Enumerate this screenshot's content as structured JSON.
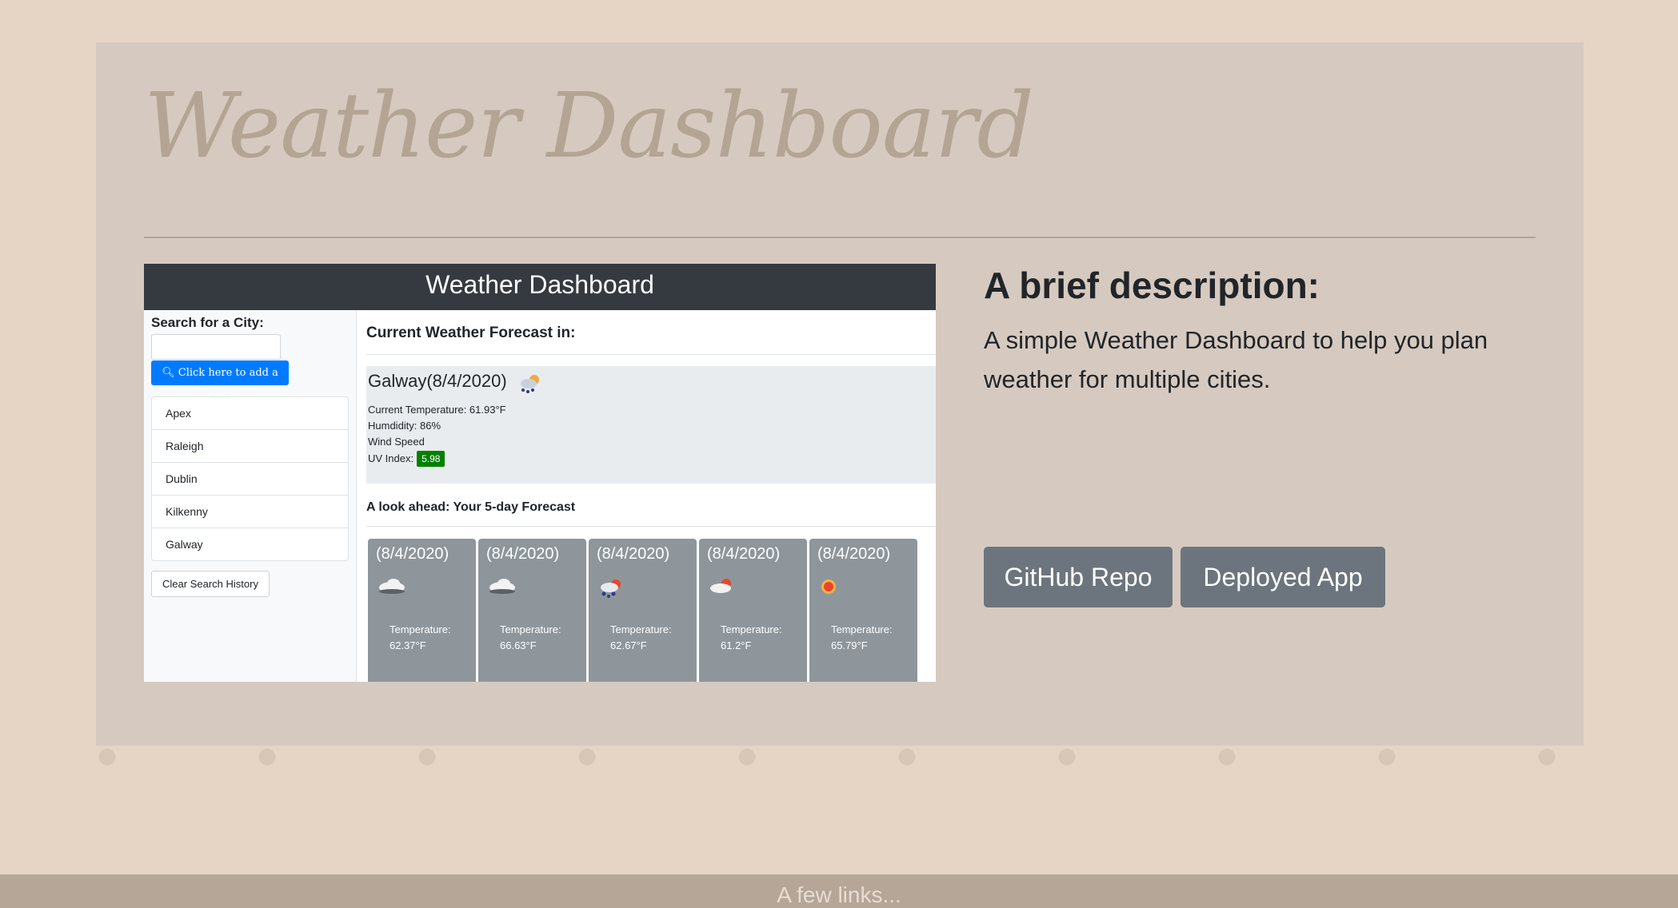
{
  "header": {
    "title": "Weather Dashboard"
  },
  "preview": {
    "app_title": "Weather Dashboard",
    "sidebar": {
      "search_label": "Search for a City:",
      "search_value": "",
      "add_button_label": "Click here to add a City!",
      "cities": [
        "Apex",
        "Raleigh",
        "Dublin",
        "Kilkenny",
        "Galway"
      ],
      "clear_button_label": "Clear Search History"
    },
    "current": {
      "section_title": "Current Weather Forecast in:",
      "city_date": "Galway(8/4/2020)",
      "icon": "rain-sun-icon",
      "temperature": "Current Temperature: 61.93°F",
      "humidity": "Humdidity: 86%",
      "wind": "Wind Speed",
      "uv_label": "UV Index:",
      "uv_value": "5.98",
      "uv_color": "#008000"
    },
    "forecast": {
      "section_title": "A look ahead: Your 5-day Forecast",
      "cards": [
        {
          "date": "(8/4/2020)",
          "icon": "cloud-icon",
          "temp_label": "Temperature:",
          "temp": "62.37°F"
        },
        {
          "date": "(8/4/2020)",
          "icon": "cloud-icon",
          "temp_label": "Temperature:",
          "temp": "66.63°F"
        },
        {
          "date": "(8/4/2020)",
          "icon": "rain-sun-icon",
          "temp_label": "Temperature:",
          "temp": "62.67°F"
        },
        {
          "date": "(8/4/2020)",
          "icon": "sun-cloud-icon",
          "temp_label": "Temperature:",
          "temp": "61.2°F"
        },
        {
          "date": "(8/4/2020)",
          "icon": "sun-icon",
          "temp_label": "Temperature:",
          "temp": "65.79°F"
        }
      ]
    }
  },
  "description": {
    "heading": "A brief description:",
    "text": "A simple Weather Dashboard to help you plan weather for multiple cities."
  },
  "buttons": {
    "github_label": "GitHub Repo",
    "deployed_label": "Deployed App"
  },
  "footer": {
    "text": "A few links..."
  },
  "colors": {
    "page_bg": "#e6d5c5",
    "panel_bg": "#d6cac0",
    "title": "#b3a494",
    "button": "#6c757d",
    "footer_bg": "#b5a697"
  }
}
